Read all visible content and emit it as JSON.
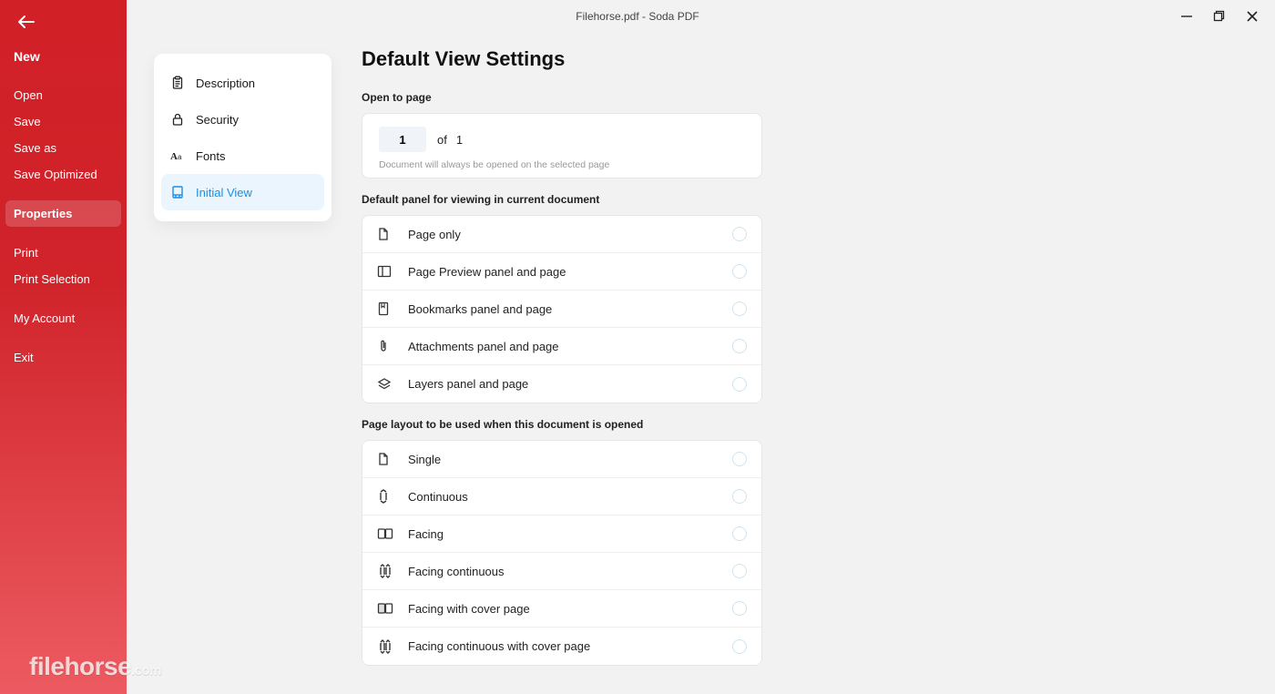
{
  "title": "Filehorse.pdf   -   Soda PDF",
  "sidebar": {
    "items": [
      {
        "label": "New",
        "bold": true
      },
      {
        "label": "Open"
      },
      {
        "label": "Save"
      },
      {
        "label": "Save as"
      },
      {
        "label": "Save Optimized"
      },
      {
        "label": "Properties",
        "selected": true
      },
      {
        "label": "Print"
      },
      {
        "label": "Print Selection"
      },
      {
        "label": "My Account"
      },
      {
        "label": "Exit"
      }
    ]
  },
  "secondary": {
    "items": [
      {
        "label": "Description",
        "icon": "clipboard-icon"
      },
      {
        "label": "Security",
        "icon": "lock-icon"
      },
      {
        "label": "Fonts",
        "icon": "fonts-icon"
      },
      {
        "label": "Initial View",
        "icon": "initial-view-icon",
        "active": true
      }
    ]
  },
  "main": {
    "title": "Default View Settings",
    "open_to_page": {
      "label": "Open to page",
      "value": "1",
      "of_label": "of",
      "total": "1",
      "hint": "Document will always be opened on the selected page"
    },
    "default_panel": {
      "label": "Default panel for viewing in current document",
      "options": [
        {
          "label": "Page only",
          "icon": "page-icon"
        },
        {
          "label": "Page Preview panel and page",
          "icon": "preview-panel-icon"
        },
        {
          "label": "Bookmarks panel and page",
          "icon": "bookmark-icon"
        },
        {
          "label": "Attachments panel and page",
          "icon": "attachment-icon"
        },
        {
          "label": "Layers panel and page",
          "icon": "layers-icon"
        }
      ]
    },
    "page_layout": {
      "label": "Page layout to be used when this document is opened",
      "options": [
        {
          "label": "Single",
          "icon": "page-icon"
        },
        {
          "label": "Continuous",
          "icon": "continuous-icon"
        },
        {
          "label": "Facing",
          "icon": "facing-icon"
        },
        {
          "label": "Facing continuous",
          "icon": "facing-continuous-icon"
        },
        {
          "label": "Facing with cover page",
          "icon": "facing-cover-icon"
        },
        {
          "label": "Facing continuous with cover page",
          "icon": "facing-continuous-cover-icon"
        }
      ]
    }
  },
  "watermark": {
    "main": "filehorse",
    "ext": ".com"
  }
}
